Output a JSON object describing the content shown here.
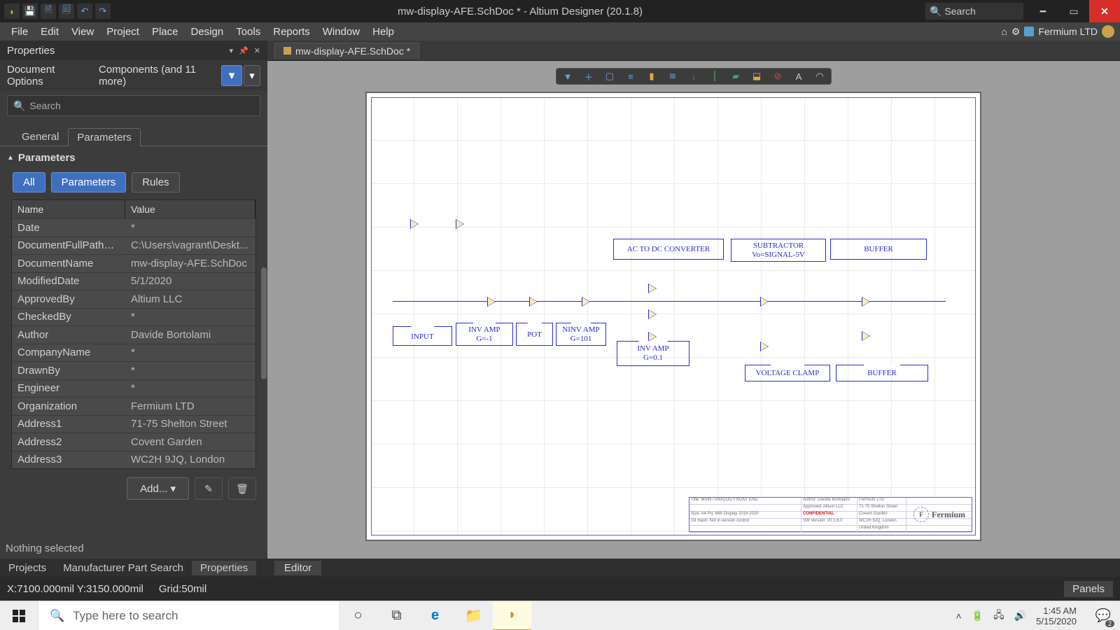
{
  "titlebar": {
    "title": "mw-display-AFE.SchDoc * - Altium Designer (20.1.8)",
    "search_placeholder": "Search"
  },
  "menubar": {
    "items": [
      "File",
      "Edit",
      "View",
      "Project",
      "Place",
      "Design",
      "Tools",
      "Reports",
      "Window",
      "Help"
    ],
    "company": "Fermium LTD"
  },
  "panel": {
    "title": "Properties",
    "doc_options": "Document Options",
    "components": "Components (and 11 more)",
    "search_placeholder": "Search",
    "tabs": {
      "general": "General",
      "parameters": "Parameters"
    },
    "section": "Parameters",
    "chips": {
      "all": "All",
      "parameters": "Parameters",
      "rules": "Rules"
    },
    "table": {
      "head_name": "Name",
      "head_value": "Value",
      "rows": [
        {
          "n": "Date",
          "v": "*"
        },
        {
          "n": "DocumentFullPathAndN...",
          "v": "C:\\Users\\vagrant\\Deskt..."
        },
        {
          "n": "DocumentName",
          "v": "mw-display-AFE.SchDoc"
        },
        {
          "n": "ModifiedDate",
          "v": "5/1/2020"
        },
        {
          "n": "ApprovedBy",
          "v": "Altium LLC"
        },
        {
          "n": "CheckedBy",
          "v": "*"
        },
        {
          "n": "Author",
          "v": "Davide Bortolami"
        },
        {
          "n": "CompanyName",
          "v": "*"
        },
        {
          "n": "DrawnBy",
          "v": "*"
        },
        {
          "n": "Engineer",
          "v": "*"
        },
        {
          "n": "Organization",
          "v": "Fermium LTD"
        },
        {
          "n": "Address1",
          "v": "71-75 Shelton Street"
        },
        {
          "n": "Address2",
          "v": "Covent Garden"
        },
        {
          "n": "Address3",
          "v": "WC2H 9JQ, London"
        }
      ]
    },
    "add_label": "Add...",
    "nothing": "Nothing selected",
    "bottom_tabs": [
      "Projects",
      "Manufacturer Part Search",
      "Properties"
    ]
  },
  "doc_tab": "mw-display-AFE.SchDoc *",
  "schematic": {
    "blocks": {
      "input": "INPUT",
      "inv_amp1_l1": "INV AMP",
      "inv_amp1_l2": "G=-1",
      "pot": "POT",
      "ninv_l1": "NINV AMP",
      "ninv_l2": "G=101",
      "ac_dc": "AC TO DC CONVERTER",
      "inv_amp2_l1": "INV AMP",
      "inv_amp2_l2": "G=0.1",
      "sub_l1": "SUBTRACTOR",
      "sub_l2": "Vo=SIGNAL-5V",
      "buffer1": "BUFFER",
      "vclamp": "VOLTAGE CLAMP",
      "buffer2": "BUFFER"
    },
    "titleblock": {
      "title": "Title:  MAIN / ANALOG FRONT END",
      "size": "Size: A4   Prj: MW Display 2019-2020",
      "author": "Author: Davide Bortolami",
      "approved": "Approved:     Altium LLC",
      "conf": "CONFIDENTIAL",
      "org": "Fermium LTD",
      "addr1": "71-75 Shelton Street",
      "addr2": "Covent Garden",
      "addr3": "WC2H 9JQ, London",
      "addr4": "United Kingdom",
      "git": "Git Hash: Not in version control",
      "sw": "SW Version:       20.1.8.0"
    },
    "editor_tab": "Editor"
  },
  "statusbar": {
    "coords": "X:7100.000mil Y:3150.000mil",
    "grid": "Grid:50mil",
    "panels": "Panels"
  },
  "taskbar": {
    "search_placeholder": "Type here to search",
    "time": "1:45 AM",
    "date": "5/15/2020",
    "notif_count": "2"
  }
}
